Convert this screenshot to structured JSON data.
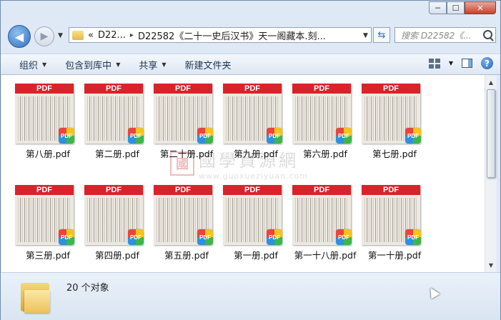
{
  "window": {
    "minimize_label": "─",
    "maximize_label": "☐",
    "close_label": "✕"
  },
  "nav": {
    "back_icon": "◀",
    "forward_icon": "▶",
    "breadcrumb": [
      "«",
      "D22...",
      "▸",
      "D22582《二十一史后汉书》天一阁藏本.刻..."
    ],
    "search_placeholder": "搜索 D22582《..."
  },
  "toolbar": {
    "organize": "组织",
    "include_in_library": "包含到库中",
    "share": "共享",
    "new_folder": "新建文件夹"
  },
  "files": [
    {
      "name": "第八册.pdf",
      "band": "PDF",
      "badge": "PDF"
    },
    {
      "name": "第二册.pdf",
      "band": "PDF",
      "badge": "PDF"
    },
    {
      "name": "第二十册.pdf",
      "band": "PDF",
      "badge": "PDF"
    },
    {
      "name": "第九册.pdf",
      "band": "PDF",
      "badge": "PDF"
    },
    {
      "name": "第六册.pdf",
      "band": "PDF",
      "badge": "PDF"
    },
    {
      "name": "第七册.pdf",
      "band": "PDF",
      "badge": "PDF"
    },
    {
      "name": "第三册.pdf",
      "band": "PDF",
      "badge": "PDF"
    },
    {
      "name": "第四册.pdf",
      "band": "PDF",
      "badge": "PDF"
    },
    {
      "name": "第五册.pdf",
      "band": "PDF",
      "badge": "PDF"
    },
    {
      "name": "第一册.pdf",
      "band": "PDF",
      "badge": "PDF"
    },
    {
      "name": "第一十八册.pdf",
      "band": "PDF",
      "badge": "PDF"
    },
    {
      "name": "第一十册.pdf",
      "band": "PDF",
      "badge": "PDF"
    }
  ],
  "watermark": {
    "seal": "國",
    "title": "國學資源網",
    "url": "www.guoxueziyuan.com"
  },
  "status": {
    "count_text": "20 个对象"
  }
}
